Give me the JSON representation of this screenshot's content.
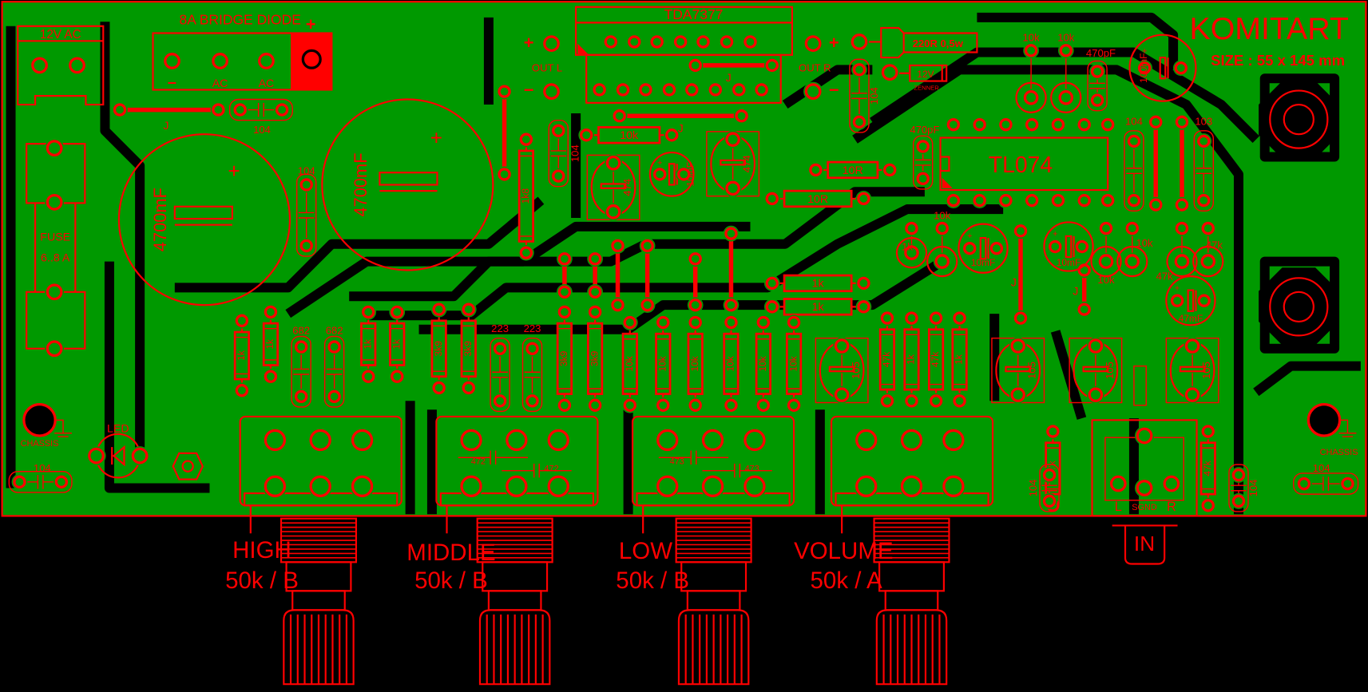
{
  "colors": {
    "copper": "#009900",
    "silkscreen": "#ff0000",
    "background": "#000000"
  },
  "board": {
    "brand": "KOMITART",
    "size": "SIZE : 55 x 145 mm",
    "power_connector": "12V AC",
    "bridge": {
      "title": "8A BRIDGE DIODE",
      "plus": "+",
      "minus": "−",
      "ac1": "AC",
      "ac2": "AC"
    },
    "main_caps": [
      "4700mF",
      "4700mF"
    ],
    "plus": "+",
    "fuse": {
      "label": "FUSE",
      "rating": "6..8 A"
    },
    "chassis": "CHASSIS",
    "led": "LED",
    "jumper": "J",
    "amp_ic": "TDA7377",
    "out_l": "OUT L",
    "out_r": "OUT R",
    "out_plus": "+",
    "out_minus": "−",
    "power_resistor": "220R 0,5w",
    "zener_value": "12V",
    "zener_label": "ZENNER",
    "opamp_ic": "TL074",
    "input": {
      "l": "L",
      "sgnd": "SGND",
      "r": "R",
      "jack": "IN"
    }
  },
  "components": [
    {
      "type": "capacitor",
      "value": "104"
    },
    {
      "type": "capacitor",
      "value": "104"
    },
    {
      "type": "resistor",
      "value": "10k"
    },
    {
      "type": "resistor",
      "value": "1k8"
    },
    {
      "type": "capacitor",
      "value": "104"
    },
    {
      "type": "capacitor",
      "value": "474"
    },
    {
      "type": "electrolytic",
      "value": "10mF"
    },
    {
      "type": "capacitor",
      "value": "474"
    },
    {
      "type": "capacitor",
      "value": "104"
    },
    {
      "type": "resistor",
      "value": "10R"
    },
    {
      "type": "resistor",
      "value": "10R"
    },
    {
      "type": "resistor",
      "value": "10k"
    },
    {
      "type": "resistor",
      "value": "10k"
    },
    {
      "type": "capacitor",
      "value": "470pF"
    },
    {
      "type": "electrolytic",
      "value": "100mF"
    },
    {
      "type": "capacitor",
      "value": "470pF"
    },
    {
      "type": "capacitor",
      "value": "104"
    },
    {
      "type": "capacitor",
      "value": "103"
    },
    {
      "type": "resistor",
      "value": "10k"
    },
    {
      "type": "resistor",
      "value": "1k"
    },
    {
      "type": "electrolytic",
      "value": "10mF"
    },
    {
      "type": "electrolytic",
      "value": "10mF"
    },
    {
      "type": "resistor",
      "value": "10k"
    },
    {
      "type": "resistor",
      "value": "10k"
    },
    {
      "type": "resistor",
      "value": "47k"
    },
    {
      "type": "resistor",
      "value": "47k"
    },
    {
      "type": "electrolytic",
      "value": "47mF"
    },
    {
      "type": "resistor",
      "value": "1k"
    },
    {
      "type": "resistor",
      "value": "1k"
    },
    {
      "type": "resistor",
      "value": "1k"
    },
    {
      "type": "resistor",
      "value": "1k"
    },
    {
      "type": "capacitor",
      "value": "682"
    },
    {
      "type": "capacitor",
      "value": "682"
    },
    {
      "type": "resistor",
      "value": "1k"
    },
    {
      "type": "resistor",
      "value": "1k"
    },
    {
      "type": "resistor",
      "value": "3k9"
    },
    {
      "type": "resistor",
      "value": "3k9"
    },
    {
      "type": "capacitor",
      "value": "223"
    },
    {
      "type": "capacitor",
      "value": "223"
    },
    {
      "type": "resistor",
      "value": "3k9"
    },
    {
      "type": "resistor",
      "value": "3k9"
    },
    {
      "type": "resistor",
      "value": "10k"
    },
    {
      "type": "resistor",
      "value": "10k"
    },
    {
      "type": "resistor",
      "value": "10k"
    },
    {
      "type": "resistor",
      "value": "10k"
    },
    {
      "type": "resistor",
      "value": "10k"
    },
    {
      "type": "resistor",
      "value": "10k"
    },
    {
      "type": "capacitor",
      "value": "105"
    },
    {
      "type": "resistor",
      "value": "47k"
    },
    {
      "type": "resistor",
      "value": "1k"
    },
    {
      "type": "resistor",
      "value": "47k"
    },
    {
      "type": "resistor",
      "value": "1k"
    },
    {
      "type": "capacitor",
      "value": "105"
    },
    {
      "type": "capacitor",
      "value": "105"
    },
    {
      "type": "capacitor",
      "value": "105"
    },
    {
      "type": "resistor",
      "value": "47k"
    },
    {
      "type": "resistor",
      "value": "47k"
    },
    {
      "type": "capacitor",
      "value": "104"
    },
    {
      "type": "capacitor",
      "value": "104"
    },
    {
      "type": "capacitor",
      "value": "104"
    },
    {
      "type": "capacitor",
      "value": "104"
    },
    {
      "type": "capacitor",
      "value": "472"
    },
    {
      "type": "capacitor",
      "value": "472"
    },
    {
      "type": "capacitor",
      "value": "473"
    },
    {
      "type": "capacitor",
      "value": "473"
    }
  ],
  "pots": [
    {
      "name": "HIGH",
      "value": "50k / B"
    },
    {
      "name": "MIDDLE",
      "value": "50k / B"
    },
    {
      "name": "LOW",
      "value": "50k / B"
    },
    {
      "name": "VOLUME",
      "value": "50k / A"
    }
  ]
}
